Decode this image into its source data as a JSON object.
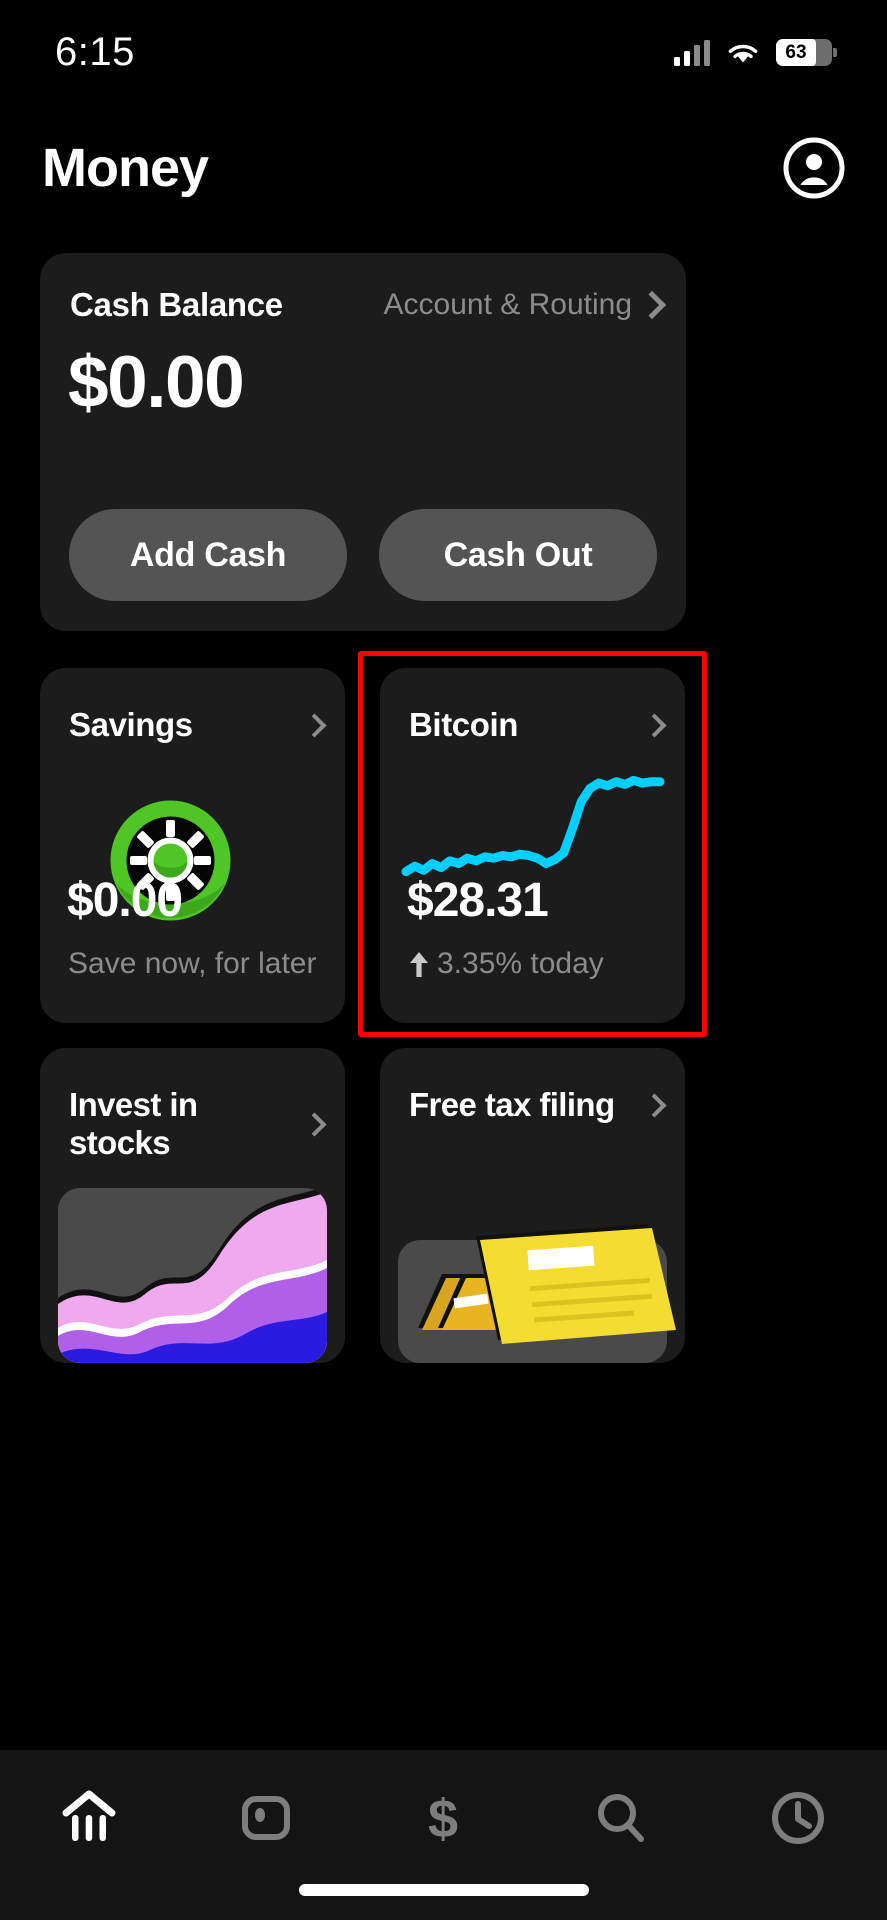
{
  "status_bar": {
    "time": "6:15",
    "battery_percent": "63",
    "cellular_icon": "cellular-signal-icon",
    "wifi_icon": "wifi-icon",
    "battery_icon": "battery-icon"
  },
  "header": {
    "title": "Money",
    "avatar_icon": "account-avatar-icon"
  },
  "cash_card": {
    "label": "Cash Balance",
    "amount": "$0.00",
    "account_routing_label": "Account & Routing",
    "chevron_icon": "chevron-right-icon",
    "add_cash_label": "Add Cash",
    "cash_out_label": "Cash Out"
  },
  "savings_card": {
    "title": "Savings",
    "amount": "$0.00",
    "subtitle": "Save now, for later",
    "icon": "savings-sun-icon",
    "chevron_icon": "chevron-right-icon",
    "accent_color": "#4ec game"
  },
  "bitcoin_card": {
    "title": "Bitcoin",
    "amount": "$28.31",
    "change_arrow": "↑",
    "change_text": "3.35% today",
    "chevron_icon": "chevron-right-icon",
    "sparkline_color": "#00cfff",
    "highlighted": true,
    "highlight_color": "#ff0000"
  },
  "promos": [
    {
      "title": "Invest in stocks",
      "chevron_icon": "chevron-right-icon",
      "art": "stocks-wave-art"
    },
    {
      "title": "Free tax filing",
      "chevron_icon": "chevron-right-icon",
      "art": "tax-documents-art"
    }
  ],
  "tab_bar": {
    "items": [
      {
        "icon": "money-home-icon",
        "active": true
      },
      {
        "icon": "card-icon",
        "active": false
      },
      {
        "icon": "dollar-payments-icon",
        "active": false
      },
      {
        "icon": "search-icon",
        "active": false
      },
      {
        "icon": "activity-clock-icon",
        "active": false
      }
    ]
  },
  "chart_data": {
    "type": "line",
    "title": "Bitcoin price sparkline",
    "series": [
      {
        "name": "Bitcoin",
        "values": [
          30,
          34,
          31,
          36,
          33,
          38,
          36,
          40,
          38,
          41,
          40,
          42,
          41,
          43,
          42,
          40,
          36,
          39,
          44,
          62,
          82,
          92,
          96,
          94,
          97,
          95,
          98,
          96,
          97,
          97
        ]
      }
    ],
    "x": [
      0,
      1,
      2,
      3,
      4,
      5,
      6,
      7,
      8,
      9,
      10,
      11,
      12,
      13,
      14,
      15,
      16,
      17,
      18,
      19,
      20,
      21,
      22,
      23,
      24,
      25,
      26,
      27,
      28,
      29
    ],
    "xlabel": "",
    "ylabel": "",
    "ylim": [
      20,
      105
    ],
    "grid": false,
    "legend": "none",
    "line_color": "#00cfff",
    "current_value": "$28.31",
    "change_percent": 3.35,
    "change_direction": "up"
  }
}
